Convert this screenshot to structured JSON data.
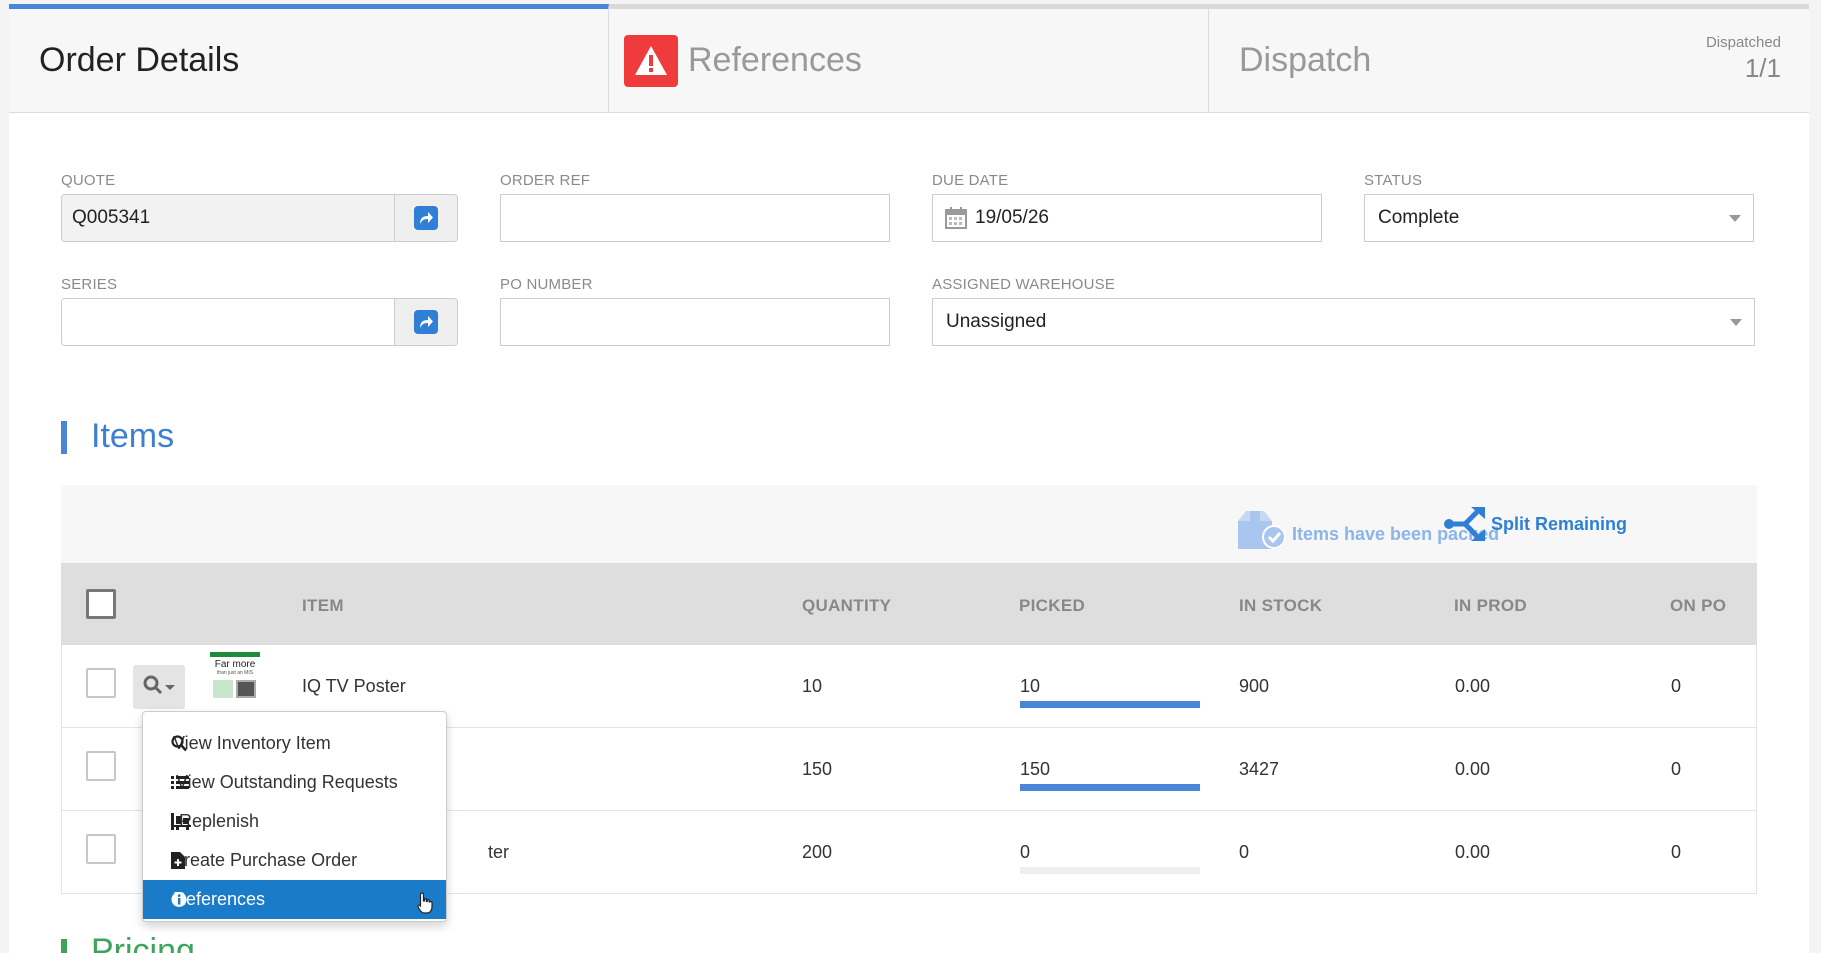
{
  "tabs": [
    {
      "label": "Order Details",
      "active": true
    },
    {
      "label": "References",
      "warning": true
    },
    {
      "label": "Dispatch",
      "count_label": "Dispatched",
      "count_value": "1/1"
    }
  ],
  "form": {
    "quote": {
      "label": "QUOTE",
      "value": "Q005341"
    },
    "order_ref": {
      "label": "ORDER REF",
      "value": ""
    },
    "due_date": {
      "label": "DUE DATE",
      "value": "19/05/26"
    },
    "status": {
      "label": "STATUS",
      "value": "Complete"
    },
    "series": {
      "label": "SERIES",
      "value": ""
    },
    "po_number": {
      "label": "PO NUMBER",
      "value": ""
    },
    "warehouse": {
      "label": "ASSIGNED WAREHOUSE",
      "value": "Unassigned"
    }
  },
  "items": {
    "title": "Items",
    "packed_label": "Items have been packed",
    "split_label": "Split Remaining",
    "columns": [
      "ITEM",
      "QUANTITY",
      "PICKED",
      "IN STOCK",
      "IN PROD",
      "ON PO"
    ],
    "rows": [
      {
        "item": "IQ TV Poster",
        "quantity": "10",
        "picked": "10",
        "picked_fraction": 1.0,
        "in_stock": "900",
        "in_prod": "0.00",
        "on_po": "0"
      },
      {
        "item": "",
        "quantity": "150",
        "picked": "150",
        "picked_fraction": 1.0,
        "in_stock": "3427",
        "in_prod": "0.00",
        "on_po": "0"
      },
      {
        "item": "ter",
        "quantity": "200",
        "picked": "0",
        "picked_fraction": 0.0,
        "in_stock": "0",
        "in_prod": "0.00",
        "on_po": "0"
      }
    ]
  },
  "thumbnail_text": [
    "Far more",
    "than just an MIS"
  ],
  "menu": [
    {
      "label": "View Inventory Item",
      "icon": "search-icon"
    },
    {
      "label": "View Outstanding Requests",
      "icon": "list-icon"
    },
    {
      "label": "Replenish",
      "icon": "pallet-icon"
    },
    {
      "label": "Create Purchase Order",
      "icon": "file-plus-icon"
    },
    {
      "label": "References",
      "icon": "info-icon",
      "highlighted": true
    }
  ],
  "pricing_title": "Pricing",
  "colors": {
    "accent": "#4a86d8",
    "warning": "#ef3b3b",
    "menu_highlight": "#1a7bc8",
    "pricing": "#3fa45b"
  }
}
